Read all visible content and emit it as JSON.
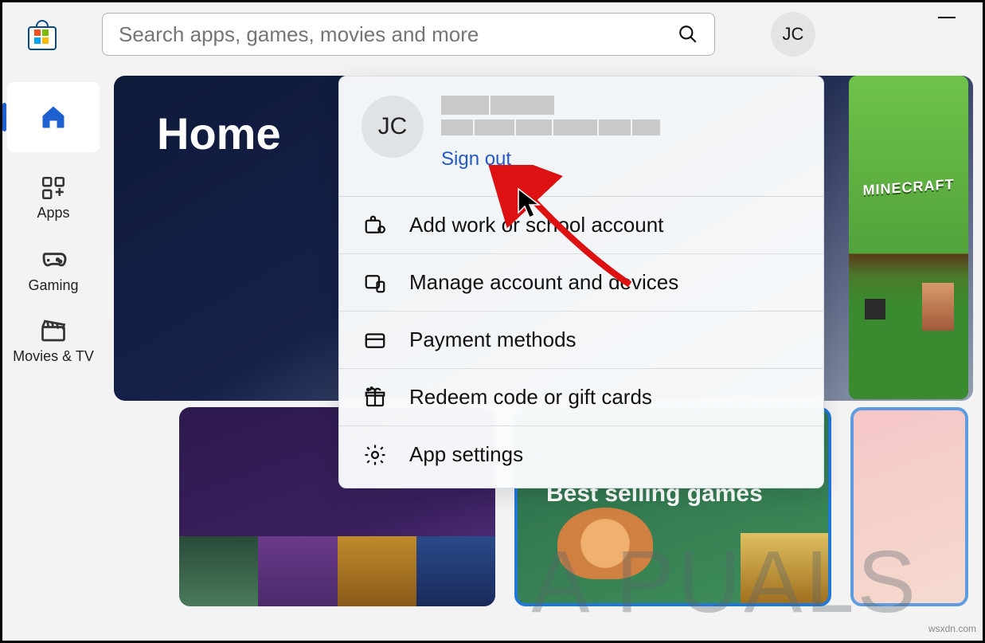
{
  "search": {
    "placeholder": "Search apps, games, movies and more"
  },
  "user": {
    "initials": "JC"
  },
  "nav": {
    "home": "",
    "apps": "Apps",
    "gaming": "Gaming",
    "movies": "Movies & TV"
  },
  "hero": {
    "title": "Home"
  },
  "flyout": {
    "initials": "JC",
    "signout": "Sign out",
    "items": [
      "Add work or school account",
      "Manage account and devices",
      "Payment methods",
      "Redeem code or gift cards",
      "App settings"
    ]
  },
  "cards": {
    "best_selling": "Best selling games"
  },
  "mc": {
    "logo": "MINECRAFT"
  },
  "watermark": {
    "text": "A  PUALS",
    "source": "wsxdn.com"
  }
}
